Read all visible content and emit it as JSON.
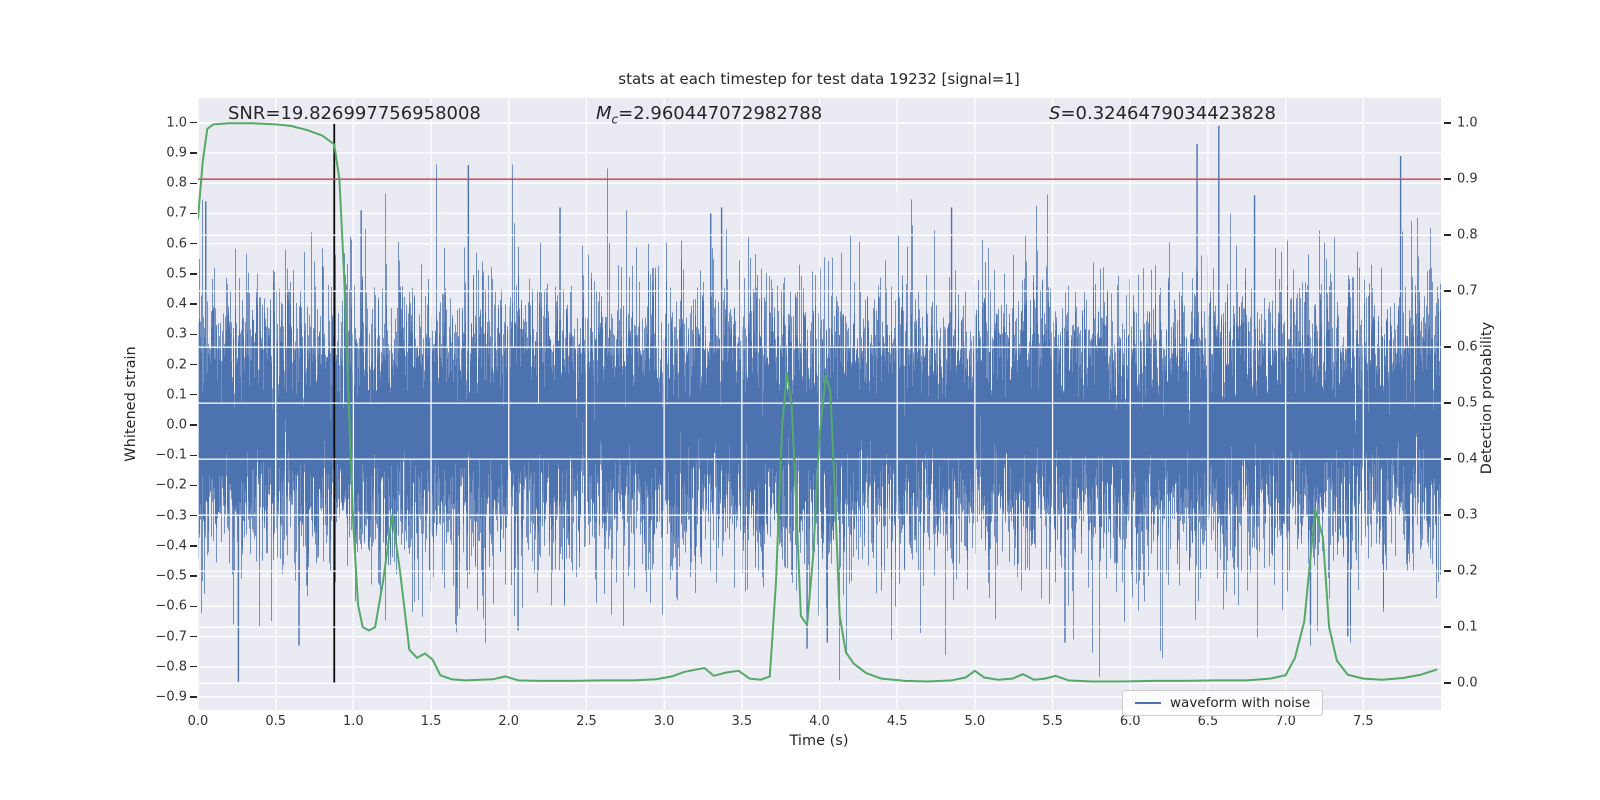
{
  "figure": {
    "title": "stats at each timestep for test data 19232 [signal=1]",
    "xlabel": "Time (s)",
    "ylabel_left": "Whitened strain",
    "ylabel_right": "Detection probability",
    "annotations": {
      "snr": "SNR=19.826997756958008",
      "mc_base": "M",
      "mc_sub": "c",
      "mc_value": "=2.960447072982788",
      "s_base": "S",
      "s_value": "=0.3246479034423828"
    },
    "legend": {
      "label": "waveform with noise"
    }
  },
  "chart_data": {
    "type": "line",
    "title": "stats at each timestep for test data 19232 [signal=1]",
    "xlabel": "Time (s)",
    "ylabel_left": "Whitened strain",
    "ylabel_right": "Detection probability",
    "grid": true,
    "background": "#eaeaf2",
    "grid_color": "#ffffff",
    "xlim": [
      0,
      8
    ],
    "ylim_left": [
      -0.943,
      1.082
    ],
    "ylim_right": [
      -0.048,
      1.045
    ],
    "xticks": {
      "values": [
        0.0,
        0.5,
        1.0,
        1.5,
        2.0,
        2.5,
        3.0,
        3.5,
        4.0,
        4.5,
        5.0,
        5.5,
        6.0,
        6.5,
        7.0,
        7.5
      ],
      "labels": [
        "0.0",
        "0.5",
        "1.0",
        "1.5",
        "2.0",
        "2.5",
        "3.0",
        "3.5",
        "4.0",
        "4.5",
        "5.0",
        "5.5",
        "6.0",
        "6.5",
        "7.0",
        "7.5"
      ]
    },
    "yticks_left": {
      "values": [
        1.0,
        0.9,
        0.8,
        0.7,
        0.6,
        0.5,
        0.4,
        0.3,
        0.2,
        0.1,
        0.0,
        -0.1,
        -0.2,
        -0.3,
        -0.4,
        -0.5,
        -0.6,
        -0.7,
        -0.8,
        -0.9
      ],
      "labels": [
        "1.0",
        "0.9",
        "0.8",
        "0.7",
        "0.6",
        "0.5",
        "0.4",
        "0.3",
        "0.2",
        "0.1",
        "0.0",
        "−0.1",
        "−0.2",
        "−0.3",
        "−0.4",
        "−0.5",
        "−0.6",
        "−0.7",
        "−0.8",
        "−0.9"
      ]
    },
    "yticks_right": {
      "values": [
        1.0,
        0.9,
        0.8,
        0.7,
        0.6,
        0.5,
        0.4,
        0.3,
        0.2,
        0.1,
        0.0
      ],
      "labels": [
        "1.0",
        "0.9",
        "0.8",
        "0.7",
        "0.6",
        "0.5",
        "0.4",
        "0.3",
        "0.2",
        "0.1",
        "0.0"
      ]
    },
    "threshold": {
      "probability": 0.9,
      "color": "#c44e52"
    },
    "event_marker": {
      "time": 0.877,
      "ymin": -0.855,
      "ymax": 0.998,
      "color": "#0a0a0a"
    },
    "series": [
      {
        "name": "waveform with noise",
        "kind": "noise",
        "axis": "left",
        "color": "#4c72b0",
        "sigma": 0.21,
        "samples_per_column": 13,
        "seed": 19232,
        "notable_extremes": [
          [
            0.05,
            0.74
          ],
          [
            0.26,
            -0.85
          ],
          [
            0.65,
            -0.73
          ],
          [
            1.05,
            0.71
          ],
          [
            1.74,
            0.86
          ],
          [
            2.06,
            -0.68
          ],
          [
            2.33,
            0.72
          ],
          [
            3.3,
            0.7
          ],
          [
            3.37,
            0.72
          ],
          [
            3.92,
            -0.74
          ],
          [
            4.05,
            -0.72
          ],
          [
            4.5,
            0.77
          ],
          [
            4.85,
            0.72
          ],
          [
            5.58,
            -0.72
          ],
          [
            6.43,
            0.93
          ],
          [
            6.57,
            0.99
          ],
          [
            6.8,
            0.76
          ],
          [
            7.16,
            -0.66
          ],
          [
            7.4,
            -0.7
          ],
          [
            7.74,
            0.89
          ]
        ]
      },
      {
        "name": "detection probability",
        "kind": "line",
        "axis": "right",
        "color": "#55a868",
        "points": [
          [
            0.0,
            0.83
          ],
          [
            0.03,
            0.93
          ],
          [
            0.06,
            0.99
          ],
          [
            0.1,
            0.998
          ],
          [
            0.2,
            1.0
          ],
          [
            0.35,
            1.0
          ],
          [
            0.5,
            0.998
          ],
          [
            0.6,
            0.995
          ],
          [
            0.7,
            0.988
          ],
          [
            0.8,
            0.978
          ],
          [
            0.877,
            0.962
          ],
          [
            0.91,
            0.9
          ],
          [
            0.94,
            0.73
          ],
          [
            0.97,
            0.5
          ],
          [
            1.0,
            0.28
          ],
          [
            1.03,
            0.14
          ],
          [
            1.06,
            0.1
          ],
          [
            1.1,
            0.094
          ],
          [
            1.14,
            0.1
          ],
          [
            1.19,
            0.18
          ],
          [
            1.25,
            0.3
          ],
          [
            1.3,
            0.2
          ],
          [
            1.36,
            0.06
          ],
          [
            1.41,
            0.045
          ],
          [
            1.46,
            0.053
          ],
          [
            1.51,
            0.042
          ],
          [
            1.56,
            0.014
          ],
          [
            1.63,
            0.007
          ],
          [
            1.72,
            0.005
          ],
          [
            1.82,
            0.006
          ],
          [
            1.9,
            0.007
          ],
          [
            1.98,
            0.012
          ],
          [
            2.06,
            0.005
          ],
          [
            2.2,
            0.004
          ],
          [
            2.4,
            0.004
          ],
          [
            2.6,
            0.005
          ],
          [
            2.8,
            0.005
          ],
          [
            2.95,
            0.007
          ],
          [
            3.05,
            0.012
          ],
          [
            3.13,
            0.02
          ],
          [
            3.2,
            0.024
          ],
          [
            3.26,
            0.027
          ],
          [
            3.32,
            0.013
          ],
          [
            3.4,
            0.019
          ],
          [
            3.48,
            0.022
          ],
          [
            3.55,
            0.008
          ],
          [
            3.62,
            0.006
          ],
          [
            3.68,
            0.012
          ],
          [
            3.72,
            0.18
          ],
          [
            3.76,
            0.46
          ],
          [
            3.79,
            0.555
          ],
          [
            3.82,
            0.5
          ],
          [
            3.85,
            0.32
          ],
          [
            3.88,
            0.12
          ],
          [
            3.92,
            0.104
          ],
          [
            3.96,
            0.23
          ],
          [
            4.0,
            0.44
          ],
          [
            4.04,
            0.55
          ],
          [
            4.07,
            0.52
          ],
          [
            4.1,
            0.33
          ],
          [
            4.13,
            0.12
          ],
          [
            4.17,
            0.055
          ],
          [
            4.22,
            0.035
          ],
          [
            4.3,
            0.018
          ],
          [
            4.4,
            0.008
          ],
          [
            4.55,
            0.004
          ],
          [
            4.7,
            0.003
          ],
          [
            4.85,
            0.005
          ],
          [
            4.94,
            0.01
          ],
          [
            5.0,
            0.022
          ],
          [
            5.06,
            0.01
          ],
          [
            5.15,
            0.006
          ],
          [
            5.24,
            0.008
          ],
          [
            5.31,
            0.016
          ],
          [
            5.38,
            0.006
          ],
          [
            5.45,
            0.008
          ],
          [
            5.52,
            0.013
          ],
          [
            5.6,
            0.005
          ],
          [
            5.75,
            0.003
          ],
          [
            5.95,
            0.003
          ],
          [
            6.15,
            0.004
          ],
          [
            6.35,
            0.004
          ],
          [
            6.55,
            0.005
          ],
          [
            6.75,
            0.005
          ],
          [
            6.9,
            0.008
          ],
          [
            7.0,
            0.014
          ],
          [
            7.06,
            0.045
          ],
          [
            7.12,
            0.11
          ],
          [
            7.19,
            0.31
          ],
          [
            7.24,
            0.26
          ],
          [
            7.28,
            0.1
          ],
          [
            7.33,
            0.04
          ],
          [
            7.4,
            0.015
          ],
          [
            7.5,
            0.008
          ],
          [
            7.62,
            0.006
          ],
          [
            7.75,
            0.009
          ],
          [
            7.87,
            0.015
          ],
          [
            7.97,
            0.024
          ]
        ]
      }
    ],
    "legend": {
      "label": "waveform with noise",
      "position": "lower right"
    }
  }
}
